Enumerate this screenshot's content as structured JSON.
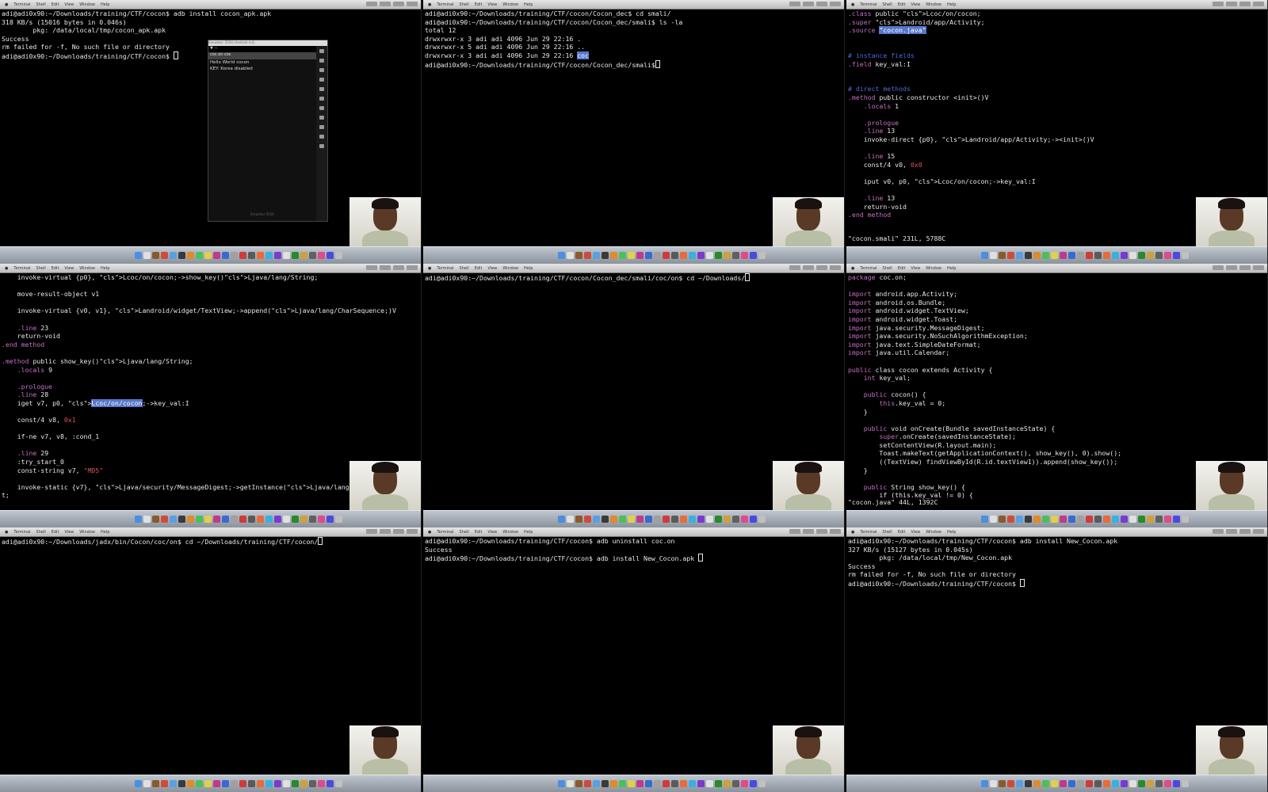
{
  "menubar": {
    "items": [
      "Terminal",
      "Shell",
      "Edit",
      "View",
      "Window",
      "Help"
    ]
  },
  "dock_colors": [
    "#4a8fe0",
    "#e0e0e0",
    "#8a5a2a",
    "#d04a3a",
    "#5aa0e0",
    "#3a3a3a",
    "#e08a2a",
    "#4ac05a",
    "#e0d04a",
    "#c03a8a",
    "#3a6ad0",
    "#a0a0a0",
    "#d03a3a",
    "#5a5a5a",
    "#ea6a3a",
    "#3ab0e0",
    "#7a3ad0",
    "#e0e0e0",
    "#2a8a2a",
    "#d0a03a",
    "#606060",
    "#e04a8a",
    "#4a4ae0",
    "#c0c0c0"
  ],
  "panels": [
    {
      "title": "",
      "emulator": {
        "window_title": "Emulator: 5554 (Android 4.4)",
        "app_title": "coc.on.coc",
        "status_icons": "▼ ☆",
        "lines": [
          "Hello World cocon",
          "KEY: Korea disabled"
        ],
        "footer": "Emulator 5554"
      },
      "lines": [
        "adi@adi0x90:~/Downloads/training/CTF/cocon$ adb install cocon_apk.apk",
        "318 KB/s (15016 bytes in 0.046s)",
        "        pkg: /data/local/tmp/cocon_apk.apk",
        "Success",
        "rm failed for -f, No such file or directory",
        "adi@adi0x90:~/Downloads/training/CTF/cocon$ "
      ]
    },
    {
      "title": "",
      "lines": [
        "adi@adi0x90:~/Downloads/training/CTF/cocon/Cocon_dec$ cd smali/",
        "adi@adi0x90:~/Downloads/training/CTF/cocon/Cocon_dec/smali$ ls -la",
        "total 12",
        "drwxrwxr-x 3 adi adi 4096 Jun 29 22:16 .",
        "drwxrwxr-x 5 adi adi 4096 Jun 29 22:16 ..",
        "drwxrwxr-x 3 adi adi 4096 Jun 29 22:16 ",
        "adi@adi0x90:~/Downloads/training/CTF/cocon/Cocon_dec/smali$"
      ],
      "hl_dir": "coc"
    },
    {
      "title": "",
      "code": [
        ".class public Lcoc/on/cocon;",
        ".super Landroid/app/Activity;",
        ".source \"cocon.java\"",
        "",
        "",
        "# instance fields",
        ".field key_val:I",
        "",
        "",
        "# direct methods",
        ".method public constructor <init>()V",
        "    .locals 1",
        "",
        "    .prologue",
        "    .line 13",
        "    invoke-direct {p0}, Landroid/app/Activity;-><init>()V",
        "",
        "    .line 15",
        "    const/4 v0, 0x0",
        "",
        "    iput v0, p0, Lcoc/on/cocon;->key_val:I",
        "",
        "    .line 13",
        "    return-void",
        ".end method"
      ],
      "status": "\"cocon.smali\" 231L, 5788C"
    },
    {
      "title": "",
      "code": [
        "    invoke-virtual {p0}, Lcoc/on/cocon;->show_key()Ljava/lang/String;",
        "",
        "    move-result-object v1",
        "",
        "    invoke-virtual {v0, v1}, Landroid/widget/TextView;->append(Ljava/lang/CharSequence;)V",
        "",
        "    .line 23",
        "    return-void",
        ".end method",
        "",
        ".method public show_key()Ljava/lang/String;",
        "    .locals 9",
        "",
        "    .prologue",
        "    .line 28",
        "    iget v7, p0, Lcoc/on/cocon;->key_val:I",
        "",
        "    const/4 v8, 0x1",
        "",
        "    if-ne v7, v8, :cond_1",
        "",
        "    .line 29",
        "    :try_start_0",
        "    const-string v7, \"MD5\"",
        "",
        "    invoke-static {v7}, Ljava/security/MessageDigest;->getInstance(Ljava/lang/String;)Ljava/s",
        "t;"
      ]
    },
    {
      "title": "",
      "lines": [
        "adi@adi0x90:~/Downloads/training/CTF/cocon/Cocon_dec/smali/coc/on$ cd ~/Downloads/"
      ]
    },
    {
      "title": "",
      "code": [
        "package coc.on;",
        "",
        "import android.app.Activity;",
        "import android.os.Bundle;",
        "import android.widget.TextView;",
        "import android.widget.Toast;",
        "import java.security.MessageDigest;",
        "import java.security.NoSuchAlgorithmException;",
        "import java.text.SimpleDateFormat;",
        "import java.util.Calendar;",
        "",
        "public class cocon extends Activity {",
        "    int key_val;",
        "",
        "    public cocon() {",
        "        this.key_val = 0;",
        "    }",
        "",
        "    public void onCreate(Bundle savedInstanceState) {",
        "        super.onCreate(savedInstanceState);",
        "        setContentView(R.layout.main);",
        "        Toast.makeText(getApplicationContext(), show_key(), 0).show();",
        "        ((TextView) findViewById(R.id.textView1)).append(show_key());",
        "    }",
        "",
        "    public String show_key() {",
        "        if (this.key_val != 0) {"
      ],
      "status": "\"cocon.java\" 44L, 1392C"
    },
    {
      "title": "",
      "lines": [
        "adi@adi0x90:~/Downloads/jadx/bin/Cocon/coc/on$ cd ~/Downloads/training/CTF/cocon/"
      ]
    },
    {
      "title": "",
      "lines": [
        "adi@adi0x90:~/Downloads/training/CTF/cocon$ adb uninstall coc.on",
        "Success",
        "adi@adi0x90:~/Downloads/training/CTF/cocon$ adb install New_Cocon.apk "
      ]
    },
    {
      "title": "",
      "lines": [
        "adi@adi0x90:~/Downloads/training/CTF/cocon$ adb install New_Cocon.apk",
        "327 KB/s (15127 bytes in 0.045s)",
        "        pkg: /data/local/tmp/New_Cocon.apk",
        "Success",
        "rm failed for -f, No such file or directory",
        "adi@adi0x90:~/Downloads/training/CTF/cocon$ "
      ]
    }
  ]
}
